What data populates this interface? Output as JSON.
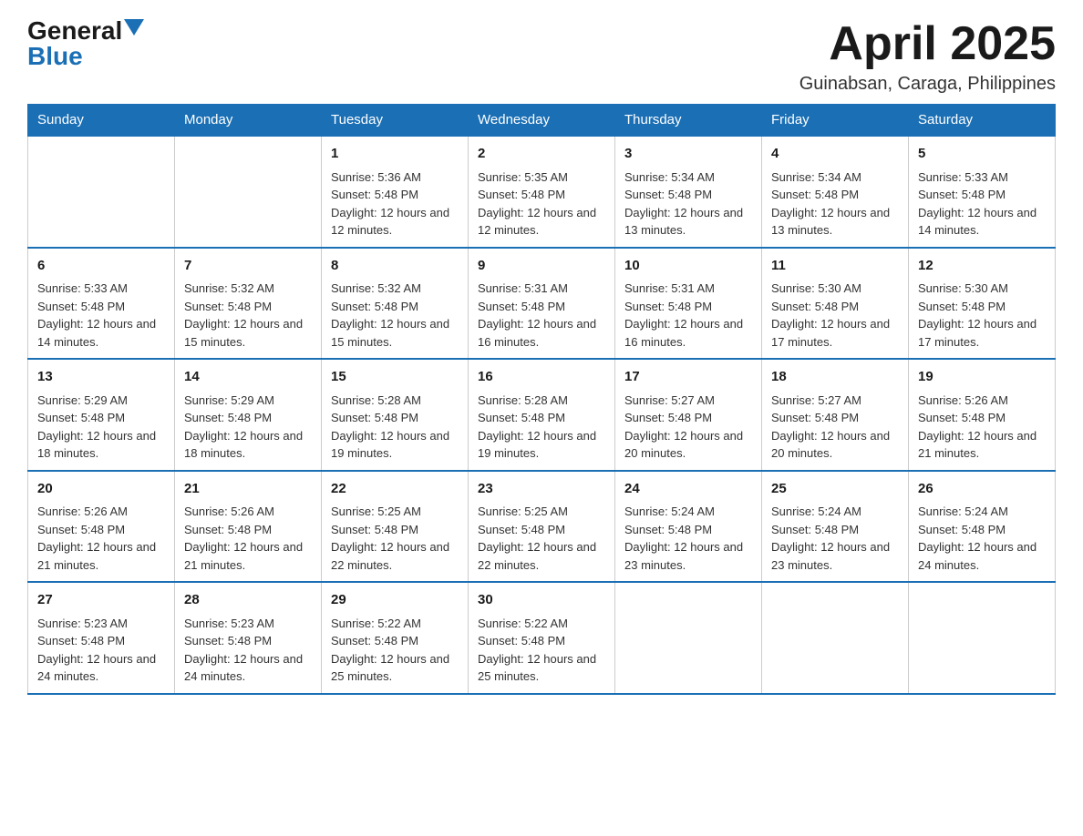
{
  "header": {
    "logo_general": "General",
    "logo_blue": "Blue",
    "month_title": "April 2025",
    "location": "Guinabsan, Caraga, Philippines"
  },
  "days_of_week": [
    "Sunday",
    "Monday",
    "Tuesday",
    "Wednesday",
    "Thursday",
    "Friday",
    "Saturday"
  ],
  "weeks": [
    [
      {
        "day": "",
        "sunrise": "",
        "sunset": "",
        "daylight": ""
      },
      {
        "day": "",
        "sunrise": "",
        "sunset": "",
        "daylight": ""
      },
      {
        "day": "1",
        "sunrise": "5:36 AM",
        "sunset": "5:48 PM",
        "daylight": "12 hours and 12 minutes."
      },
      {
        "day": "2",
        "sunrise": "5:35 AM",
        "sunset": "5:48 PM",
        "daylight": "12 hours and 12 minutes."
      },
      {
        "day": "3",
        "sunrise": "5:34 AM",
        "sunset": "5:48 PM",
        "daylight": "12 hours and 13 minutes."
      },
      {
        "day": "4",
        "sunrise": "5:34 AM",
        "sunset": "5:48 PM",
        "daylight": "12 hours and 13 minutes."
      },
      {
        "day": "5",
        "sunrise": "5:33 AM",
        "sunset": "5:48 PM",
        "daylight": "12 hours and 14 minutes."
      }
    ],
    [
      {
        "day": "6",
        "sunrise": "5:33 AM",
        "sunset": "5:48 PM",
        "daylight": "12 hours and 14 minutes."
      },
      {
        "day": "7",
        "sunrise": "5:32 AM",
        "sunset": "5:48 PM",
        "daylight": "12 hours and 15 minutes."
      },
      {
        "day": "8",
        "sunrise": "5:32 AM",
        "sunset": "5:48 PM",
        "daylight": "12 hours and 15 minutes."
      },
      {
        "day": "9",
        "sunrise": "5:31 AM",
        "sunset": "5:48 PM",
        "daylight": "12 hours and 16 minutes."
      },
      {
        "day": "10",
        "sunrise": "5:31 AM",
        "sunset": "5:48 PM",
        "daylight": "12 hours and 16 minutes."
      },
      {
        "day": "11",
        "sunrise": "5:30 AM",
        "sunset": "5:48 PM",
        "daylight": "12 hours and 17 minutes."
      },
      {
        "day": "12",
        "sunrise": "5:30 AM",
        "sunset": "5:48 PM",
        "daylight": "12 hours and 17 minutes."
      }
    ],
    [
      {
        "day": "13",
        "sunrise": "5:29 AM",
        "sunset": "5:48 PM",
        "daylight": "12 hours and 18 minutes."
      },
      {
        "day": "14",
        "sunrise": "5:29 AM",
        "sunset": "5:48 PM",
        "daylight": "12 hours and 18 minutes."
      },
      {
        "day": "15",
        "sunrise": "5:28 AM",
        "sunset": "5:48 PM",
        "daylight": "12 hours and 19 minutes."
      },
      {
        "day": "16",
        "sunrise": "5:28 AM",
        "sunset": "5:48 PM",
        "daylight": "12 hours and 19 minutes."
      },
      {
        "day": "17",
        "sunrise": "5:27 AM",
        "sunset": "5:48 PM",
        "daylight": "12 hours and 20 minutes."
      },
      {
        "day": "18",
        "sunrise": "5:27 AM",
        "sunset": "5:48 PM",
        "daylight": "12 hours and 20 minutes."
      },
      {
        "day": "19",
        "sunrise": "5:26 AM",
        "sunset": "5:48 PM",
        "daylight": "12 hours and 21 minutes."
      }
    ],
    [
      {
        "day": "20",
        "sunrise": "5:26 AM",
        "sunset": "5:48 PM",
        "daylight": "12 hours and 21 minutes."
      },
      {
        "day": "21",
        "sunrise": "5:26 AM",
        "sunset": "5:48 PM",
        "daylight": "12 hours and 21 minutes."
      },
      {
        "day": "22",
        "sunrise": "5:25 AM",
        "sunset": "5:48 PM",
        "daylight": "12 hours and 22 minutes."
      },
      {
        "day": "23",
        "sunrise": "5:25 AM",
        "sunset": "5:48 PM",
        "daylight": "12 hours and 22 minutes."
      },
      {
        "day": "24",
        "sunrise": "5:24 AM",
        "sunset": "5:48 PM",
        "daylight": "12 hours and 23 minutes."
      },
      {
        "day": "25",
        "sunrise": "5:24 AM",
        "sunset": "5:48 PM",
        "daylight": "12 hours and 23 minutes."
      },
      {
        "day": "26",
        "sunrise": "5:24 AM",
        "sunset": "5:48 PM",
        "daylight": "12 hours and 24 minutes."
      }
    ],
    [
      {
        "day": "27",
        "sunrise": "5:23 AM",
        "sunset": "5:48 PM",
        "daylight": "12 hours and 24 minutes."
      },
      {
        "day": "28",
        "sunrise": "5:23 AM",
        "sunset": "5:48 PM",
        "daylight": "12 hours and 24 minutes."
      },
      {
        "day": "29",
        "sunrise": "5:22 AM",
        "sunset": "5:48 PM",
        "daylight": "12 hours and 25 minutes."
      },
      {
        "day": "30",
        "sunrise": "5:22 AM",
        "sunset": "5:48 PM",
        "daylight": "12 hours and 25 minutes."
      },
      {
        "day": "",
        "sunrise": "",
        "sunset": "",
        "daylight": ""
      },
      {
        "day": "",
        "sunrise": "",
        "sunset": "",
        "daylight": ""
      },
      {
        "day": "",
        "sunrise": "",
        "sunset": "",
        "daylight": ""
      }
    ]
  ],
  "labels": {
    "sunrise_prefix": "Sunrise: ",
    "sunset_prefix": "Sunset: ",
    "daylight_prefix": "Daylight: "
  }
}
